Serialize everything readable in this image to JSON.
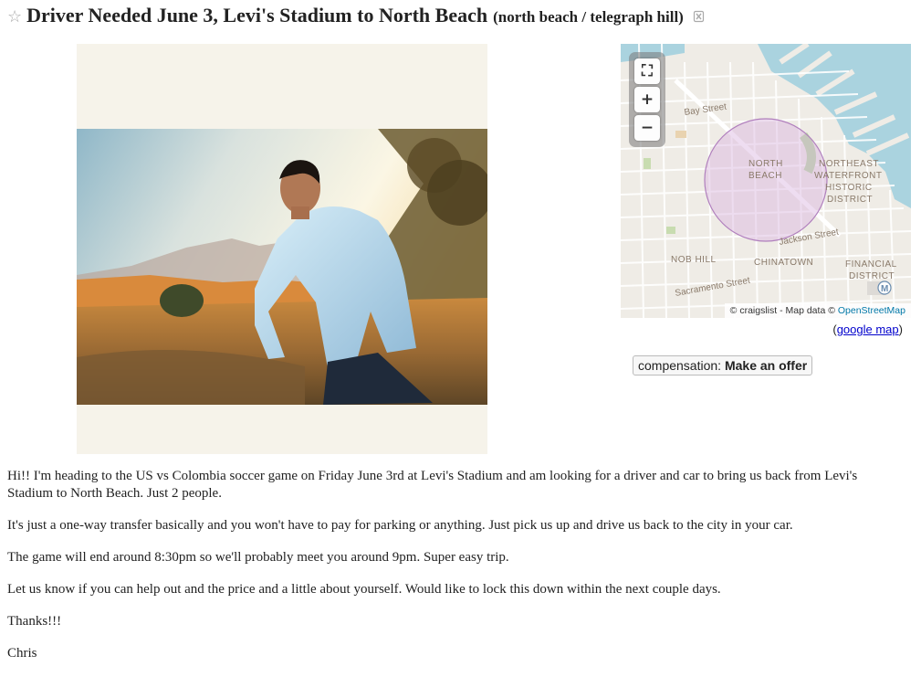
{
  "posting": {
    "title": "Driver Needed June 3, Levi's Stadium to North Beach",
    "neighborhood": "(north beach / telegraph hill)"
  },
  "map": {
    "labels": {
      "bay_street": "Bay Street",
      "north_beach_1": "NORTH",
      "north_beach_2": "BEACH",
      "waterfront_1": "NORTHEAST",
      "waterfront_2": "WATERFRONT",
      "waterfront_3": "HISTORIC",
      "waterfront_4": "DISTRICT",
      "jackson_street": "Jackson Street",
      "nob_hill": "NOB HILL",
      "chinatown": "CHINATOWN",
      "financial_1": "FINANCIAL",
      "financial_2": "DISTRICT",
      "sacramento_street": "Sacramento Street",
      "muni": "M"
    },
    "attribution_prefix": "© craigslist - Map data ©",
    "attribution_link": "OpenStreetMap",
    "controls": {
      "fullscreen": "⛶",
      "zoom_in": "+",
      "zoom_out": "−"
    }
  },
  "google_map": {
    "open": "(",
    "link": "google map",
    "close": ")"
  },
  "attributes": {
    "compensation_label": "compensation: ",
    "compensation_value": "Make an offer"
  },
  "body": {
    "paragraphs": [
      "Hi!! I'm heading to the US vs Colombia soccer game on Friday June 3rd at Levi's Stadium and am looking for a driver and car to bring us back from Levi's Stadium to North Beach. Just 2 people.",
      "It's just a one-way transfer basically and you won't have to pay for parking or anything. Just pick us up and drive us back to the city in your car.",
      "The game will end around 8:30pm so we'll probably meet you around 9pm. Super easy trip.",
      "Let us know if you can help out and the price and a little about yourself. Would like to lock this down within the next couple days.",
      "Thanks!!!",
      "Chris"
    ]
  },
  "colors": {
    "map_water": "#aad3df",
    "map_land": "#efece6",
    "radius_fill": "#d9b3df",
    "link": "#0000cc"
  }
}
